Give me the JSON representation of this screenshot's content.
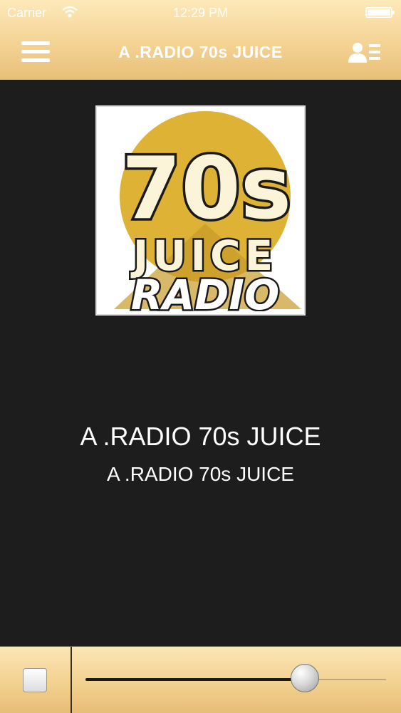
{
  "status_bar": {
    "carrier": "Carrier",
    "time": "12:29 PM"
  },
  "nav": {
    "title": "A .RADIO 70s JUICE",
    "menu_icon": "hamburger-menu-icon",
    "contact_icon": "contact-list-icon"
  },
  "logo": {
    "line1": "70s",
    "line2": "JUICE",
    "line3": "RADIO",
    "gold": "#ddb235",
    "cream": "#fbf4d9"
  },
  "now_playing": {
    "title": "A .RADIO 70s JUICE",
    "subtitle": "A .RADIO 70s JUICE"
  },
  "player": {
    "stop_icon": "stop-icon",
    "volume": 0.73
  },
  "colors": {
    "bar_top": "#fde9b9",
    "bar_bottom": "#e8bf78",
    "background": "#1d1d1d"
  }
}
